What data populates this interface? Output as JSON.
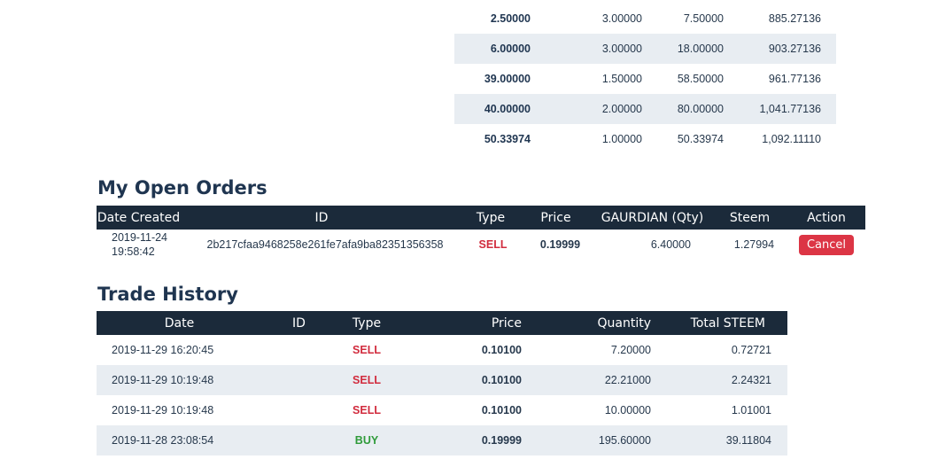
{
  "order_book": {
    "rows": [
      [
        "2.50000",
        "3.00000",
        "7.50000",
        "885.27136"
      ],
      [
        "6.00000",
        "3.00000",
        "18.00000",
        "903.27136"
      ],
      [
        "39.00000",
        "1.50000",
        "58.50000",
        "961.77136"
      ],
      [
        "40.00000",
        "2.00000",
        "80.00000",
        "1,041.77136"
      ],
      [
        "50.33974",
        "1.00000",
        "50.33974",
        "1,092.11110"
      ]
    ]
  },
  "open_orders": {
    "title": "My Open Orders",
    "headers": [
      "Date Created",
      "ID",
      "Type",
      "Price",
      "GAURDIAN (Qty)",
      "Steem",
      "Action"
    ],
    "rows": [
      {
        "date": "2019-11-24",
        "time": "19:58:42",
        "id": "2b217cfaa9468258e261fe7afa9ba82351356358",
        "type": "SELL",
        "price": "0.19999",
        "qty": "6.40000",
        "steem": "1.27994",
        "action": "Cancel"
      }
    ]
  },
  "trade_history": {
    "title": "Trade History",
    "headers": [
      "Date",
      "ID",
      "Type",
      "Price",
      "Quantity",
      "Total STEEM"
    ],
    "rows": [
      {
        "date": "2019-11-29 16:20:45",
        "id": "",
        "type": "SELL",
        "price": "0.10100",
        "quantity": "7.20000",
        "total": "0.72721"
      },
      {
        "date": "2019-11-29 10:19:48",
        "id": "",
        "type": "SELL",
        "price": "0.10100",
        "quantity": "22.21000",
        "total": "2.24321"
      },
      {
        "date": "2019-11-29 10:19:48",
        "id": "",
        "type": "SELL",
        "price": "0.10100",
        "quantity": "10.00000",
        "total": "1.01001"
      },
      {
        "date": "2019-11-28 23:08:54",
        "id": "",
        "type": "BUY",
        "price": "0.19999",
        "quantity": "195.60000",
        "total": "39.11804"
      }
    ]
  },
  "colors": {
    "sell": "#d12b3d",
    "buy": "#2f9b3a",
    "header_bg": "#1b2a3a",
    "stripe": "#e8edf2",
    "cancel": "#dc3545"
  }
}
